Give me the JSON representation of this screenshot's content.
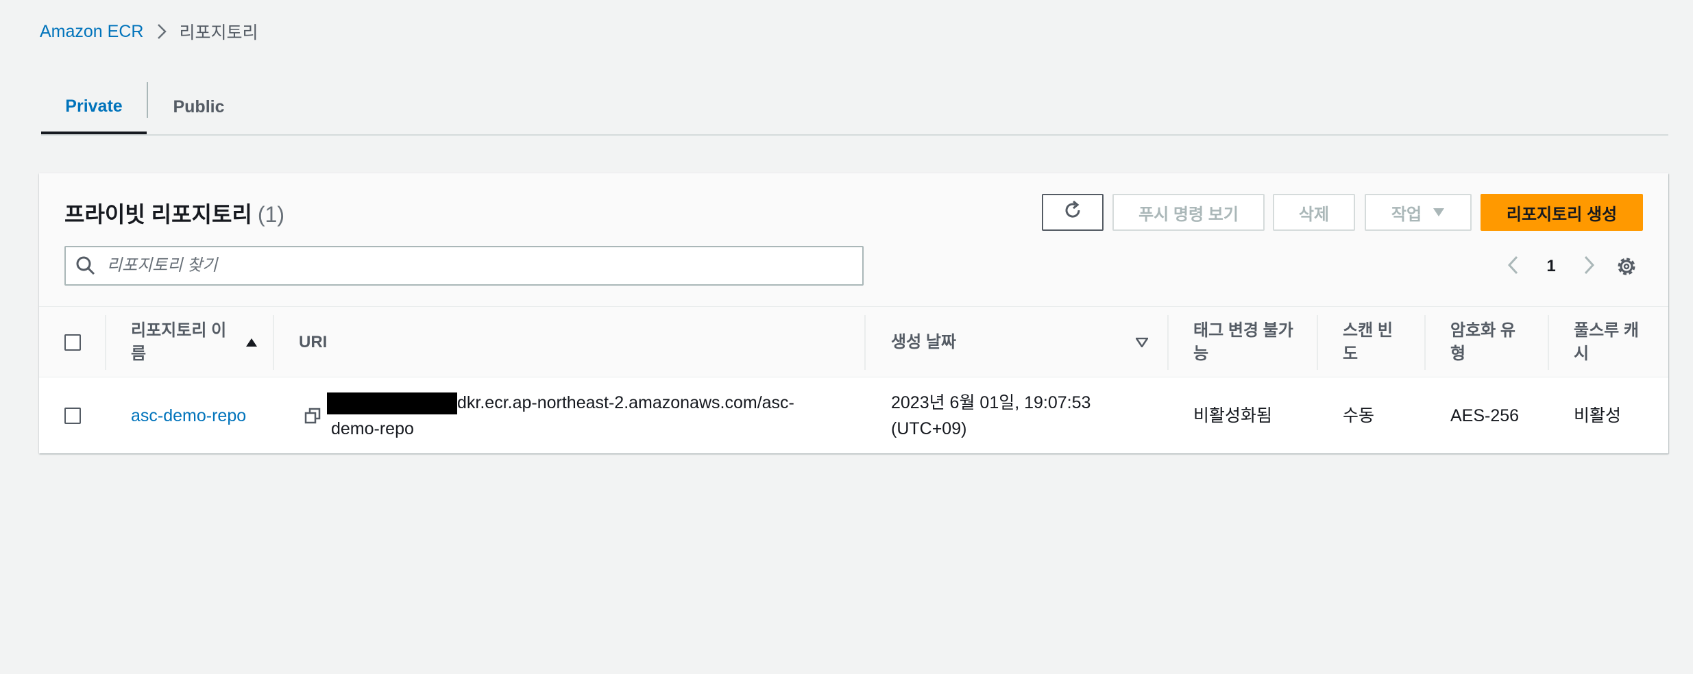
{
  "breadcrumb": {
    "root": "Amazon ECR",
    "current": "리포지토리"
  },
  "tabs": [
    {
      "label": "Private"
    },
    {
      "label": "Public"
    }
  ],
  "panel": {
    "title": "프라이빗 리포지토리",
    "count": "(1)",
    "buttons": {
      "push": "푸시 명령 보기",
      "delete": "삭제",
      "actions": "작업",
      "create": "리포지토리 생성"
    },
    "search_placeholder": "리포지토리 찾기",
    "page": "1"
  },
  "table": {
    "headers": {
      "name_line1": "리포지토리 이",
      "name_line2": "름",
      "uri": "URI",
      "created": "생성 날짜",
      "tag_line1": "태그 변경 불가",
      "tag_line2": "능",
      "scan_line1": "스캔 빈",
      "scan_line2": "도",
      "enc_line1": "암호화 유",
      "enc_line2": "형",
      "pull_line1": "풀스루 캐",
      "pull_line2": "시"
    },
    "rows": [
      {
        "name": "asc-demo-repo",
        "uri_line1": "dkr.ecr.ap-northeast-2.amazonaws.com/asc-",
        "uri_line2": "demo-repo",
        "created_line1": "2023년 6월 01일, 19:07:53",
        "created_line2": "(UTC+09)",
        "tag_immutability": "비활성화됨",
        "scan_frequency": "수동",
        "encryption": "AES-256",
        "pull_through": "비활성"
      }
    ]
  },
  "colors": {
    "link": "#0073bb",
    "primary_button": "#ff9900",
    "background": "#f2f3f3"
  },
  "icons": [
    "chevron-right-icon",
    "refresh-icon",
    "caret-down-icon",
    "search-icon",
    "chevron-left-icon",
    "gear-icon",
    "sort-asc-icon",
    "sort-desc-icon",
    "copy-icon"
  ]
}
